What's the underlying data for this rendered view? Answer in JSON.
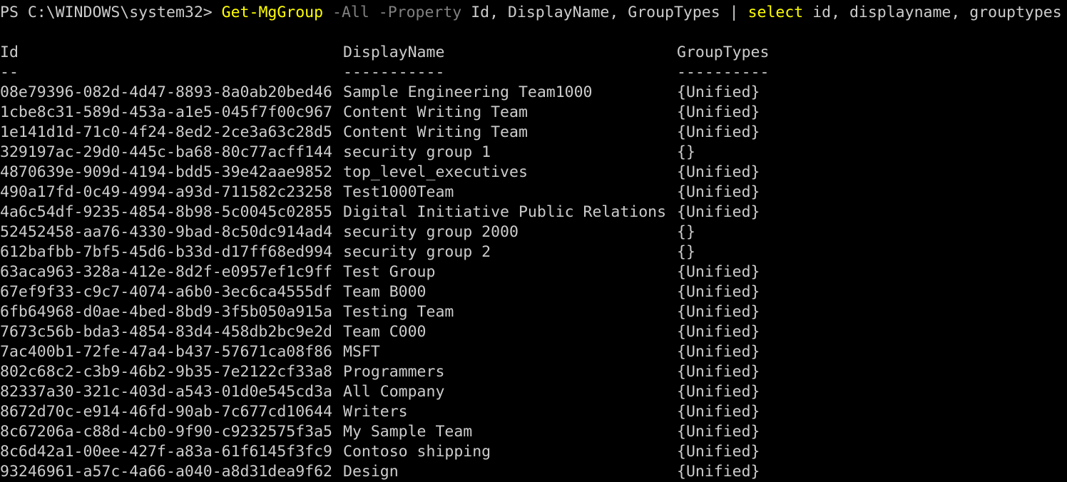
{
  "window": {
    "background": "#000000",
    "foreground": "#cccccc",
    "command_color": "#ffff00",
    "parameter_color": "#808080"
  },
  "prompt": {
    "path": "PS C:\\WINDOWS\\system32>",
    "cmdlet": "Get-MgGroup",
    "param1": "-All",
    "param2": "-Property",
    "args": "Id, DisplayName, GroupTypes",
    "pipe": "|",
    "select_cmd": "select",
    "select_args": "id, displayname, grouptypes"
  },
  "table": {
    "headers": {
      "id": "Id",
      "name": "DisplayName",
      "types": "GroupTypes"
    },
    "underlines": {
      "id": "--",
      "name": "-----------",
      "types": "----------"
    },
    "rows": [
      {
        "id": "08e79396-082d-4d47-8893-8a0ab20bed46",
        "name": "Sample Engineering Team1000",
        "types": "{Unified}"
      },
      {
        "id": "1cbe8c31-589d-453a-a1e5-045f7f00c967",
        "name": "Content Writing Team",
        "types": "{Unified}"
      },
      {
        "id": "1e141d1d-71c0-4f24-8ed2-2ce3a63c28d5",
        "name": "Content Writing Team",
        "types": "{Unified}"
      },
      {
        "id": "329197ac-29d0-445c-ba68-80c77acff144",
        "name": "security group 1",
        "types": "{}"
      },
      {
        "id": "4870639e-909d-4194-bdd5-39e42aae9852",
        "name": "top_level_executives",
        "types": "{Unified}"
      },
      {
        "id": "490a17fd-0c49-4994-a93d-711582c23258",
        "name": "Test1000Team",
        "types": "{Unified}"
      },
      {
        "id": "4a6c54df-9235-4854-8b98-5c0045c02855",
        "name": "Digital Initiative Public Relations",
        "types": "{Unified}"
      },
      {
        "id": "52452458-aa76-4330-9bad-8c50dc914ad4",
        "name": "security group 2000",
        "types": "{}"
      },
      {
        "id": "612bafbb-7bf5-45d6-b33d-d17ff68ed994",
        "name": "security group 2",
        "types": "{}"
      },
      {
        "id": "63aca963-328a-412e-8d2f-e0957ef1c9ff",
        "name": "Test Group",
        "types": "{Unified}"
      },
      {
        "id": "67ef9f33-c9c7-4074-a6b0-3ec6ca4555df",
        "name": "Team B000",
        "types": "{Unified}"
      },
      {
        "id": "6fb64968-d0ae-4bed-8bd9-3f5b050a915a",
        "name": "Testing Team",
        "types": "{Unified}"
      },
      {
        "id": "7673c56b-bda3-4854-83d4-458db2bc9e2d",
        "name": "Team C000",
        "types": "{Unified}"
      },
      {
        "id": "7ac400b1-72fe-47a4-b437-57671ca08f86",
        "name": "MSFT",
        "types": "{Unified}"
      },
      {
        "id": "802c68c2-c3b9-46b2-9b35-7e2122cf33a8",
        "name": "Programmers",
        "types": "{Unified}"
      },
      {
        "id": "82337a30-321c-403d-a543-01d0e545cd3a",
        "name": "All Company",
        "types": "{Unified}"
      },
      {
        "id": "8672d70c-e914-46fd-90ab-7c677cd10644",
        "name": "Writers",
        "types": "{Unified}"
      },
      {
        "id": "8c67206a-c88d-4cb0-9f90-c9232575f3a5",
        "name": "My Sample Team",
        "types": "{Unified}"
      },
      {
        "id": "8c6d42a1-00ee-427f-a83a-61f6145f3fc9",
        "name": "Contoso shipping",
        "types": "{Unified}"
      },
      {
        "id": "93246961-a57c-4a66-a040-a8d31dea9f62",
        "name": "Design",
        "types": "{Unified}"
      }
    ]
  }
}
